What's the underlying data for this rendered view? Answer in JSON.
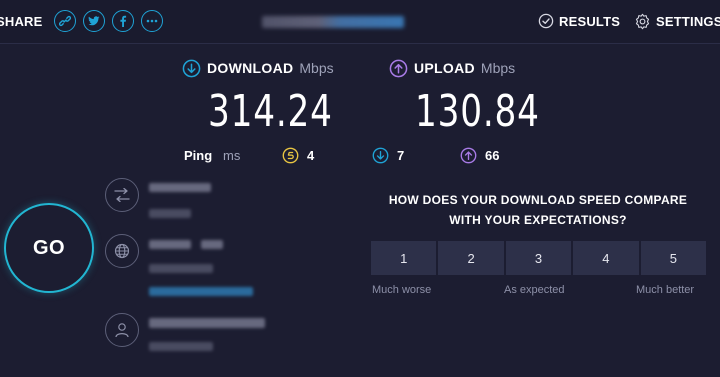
{
  "header": {
    "share_label": "SHARE",
    "share_icons": [
      "link-icon",
      "twitter-icon",
      "facebook-icon",
      "more-icon"
    ],
    "results_label": "RESULTS",
    "settings_label": "SETTINGS"
  },
  "metrics": {
    "download": {
      "label": "DOWNLOAD",
      "unit": "Mbps",
      "value": "314.24"
    },
    "upload": {
      "label": "UPLOAD",
      "unit": "Mbps",
      "value": "130.84"
    }
  },
  "ping": {
    "label": "Ping",
    "unit": "ms",
    "idle": "4",
    "download": "7",
    "upload": "66"
  },
  "go_label": "GO",
  "survey": {
    "question_line1": "HOW DOES YOUR DOWNLOAD SPEED COMPARE",
    "question_line2": "WITH YOUR EXPECTATIONS?",
    "options": [
      "1",
      "2",
      "3",
      "4",
      "5"
    ],
    "low_label": "Much worse",
    "mid_label": "As expected",
    "high_label": "Much better"
  },
  "colors": {
    "background": "#1c1d31",
    "accent_cyan": "#22b6d2",
    "download": "#1fa3d6",
    "upload": "#a87be6",
    "ping_idle": "#e8c542"
  }
}
